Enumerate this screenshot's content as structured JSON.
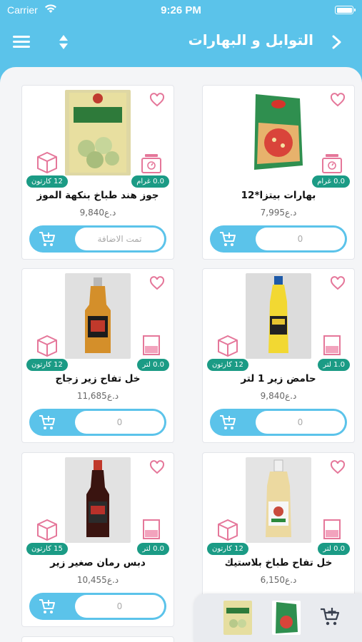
{
  "status": {
    "carrier": "Carrier",
    "time": "9:26 PM"
  },
  "header": {
    "title": "التوابل و البهارات"
  },
  "products": [
    {
      "name": "بهارات بيتزا*12",
      "price": "7,995د.ع",
      "unit": "0.0 غرام",
      "pack": "",
      "qty": "0",
      "unit_type": "scale-icon"
    },
    {
      "name": "جوز هند طباخ بنكهة الموز",
      "price": "9,840د.ع",
      "unit": "0.0 غرام",
      "pack": "12 كارتون",
      "qty": "تمت الاضافة",
      "unit_type": "scale-icon"
    },
    {
      "name": "حامض زير 1 لتر",
      "price": "9,840د.ع",
      "unit": "1.0 لتر",
      "pack": "12 كارتون",
      "qty": "0",
      "unit_type": "beaker-icon"
    },
    {
      "name": "خل تفاح زير زجاج",
      "price": "11,685د.ع",
      "unit": "0.0 لتر",
      "pack": "12 كارتون",
      "qty": "0",
      "unit_type": "beaker-icon"
    },
    {
      "name": "خل تفاح طباخ بلاستيك",
      "price": "6,150د.ع",
      "unit": "0.0 لتر",
      "pack": "12 كارتون",
      "qty": "",
      "unit_type": "beaker-icon"
    },
    {
      "name": "دبس رمان صغير زير",
      "price": "10,455د.ع",
      "unit": "0.0 لتر",
      "pack": "15 كارتون",
      "qty": "0",
      "unit_type": "beaker-icon"
    }
  ],
  "colors": {
    "accent": "#5bc3ea",
    "badge": "#1b9b85",
    "icon": "#e5779a"
  }
}
